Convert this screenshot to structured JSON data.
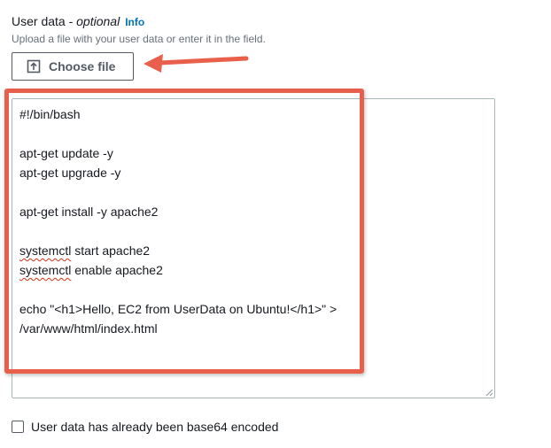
{
  "field": {
    "label": "User data - ",
    "label_optional": "optional",
    "info_link": "Info",
    "description": "Upload a file with your user data or enter it in the field."
  },
  "choose_file": {
    "label": "Choose file",
    "icon": "upload-icon"
  },
  "user_data": {
    "lines": [
      "#!/bin/bash",
      "",
      "apt-get update -y",
      "apt-get upgrade -y",
      "",
      "apt-get install -y apache2",
      "",
      "systemctl start apache2",
      "systemctl enable apache2",
      "",
      "echo \"<h1>Hello, EC2 from UserData on Ubuntu!</h1>\" > /var/www/html/index.html"
    ],
    "squiggle_word": "systemctl",
    "start_rest": " start apache2",
    "enable_rest": " enable apache2"
  },
  "base64_checkbox": {
    "label": "User data has already been base64 encoded",
    "checked": false
  },
  "colors": {
    "annotation": "#e8604c",
    "link": "#0073bb",
    "border": "#aab7b8"
  }
}
